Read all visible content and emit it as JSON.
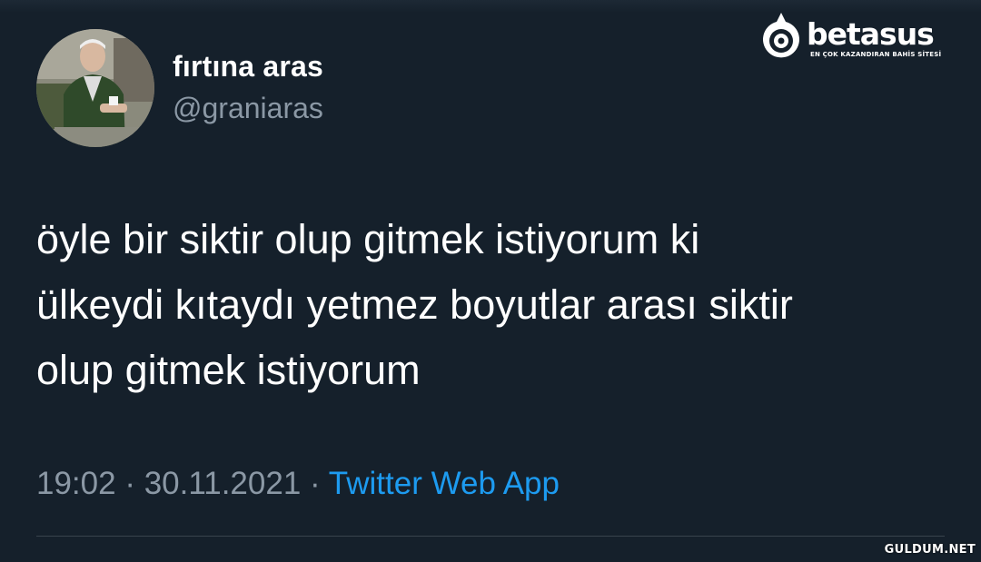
{
  "tweet": {
    "author": {
      "display_name": "fırtına aras",
      "handle": "@graniaras"
    },
    "text_lines": [
      "öyle bir siktir olup gitmek istiyorum ki",
      "ülkeydi kıtaydı yetmez boyutlar arası siktir",
      "olup gitmek istiyorum"
    ],
    "time": "19:02",
    "date": "30.11.2021",
    "separator": "·",
    "source": "Twitter Web App"
  },
  "overlay": {
    "brand_name": "betasus",
    "brand_tagline": "EN ÇOK KAZANDIRAN BAHİS SİTESİ",
    "watermark": "GULDUM.NET"
  },
  "colors": {
    "background": "#15202b",
    "primary_text": "#ffffff",
    "secondary_text": "#8b98a5",
    "link": "#1d9bf0",
    "divider": "#38444d"
  },
  "icons": {
    "brand_logo": "target-drop-icon"
  }
}
